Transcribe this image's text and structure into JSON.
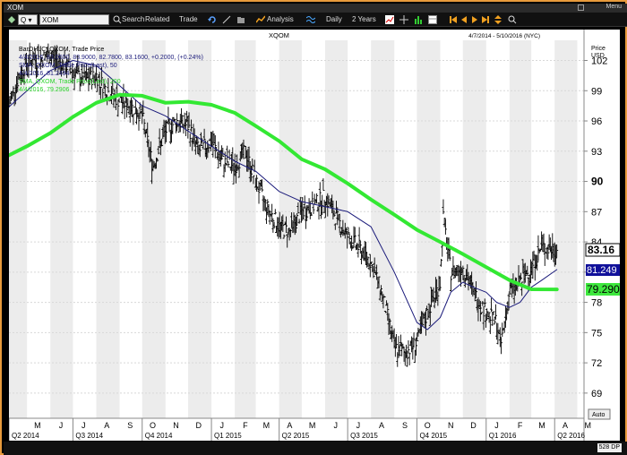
{
  "window": {
    "title": "XOM",
    "menu_label": "Menu"
  },
  "toolbar": {
    "type_selector": "Q",
    "symbol_value": "XOM",
    "search_label": "Search",
    "related_label": "Related",
    "trade_label": "Trade",
    "analysis_label": "Analysis",
    "interval_label": "Daily",
    "range_label": "2 Years"
  },
  "chart_header": {
    "symbol_title": "XQOM",
    "date_range": "4/7/2014 - 5/10/2016 (NYC)",
    "price_label_1": "Price",
    "price_label_2": "USD",
    "legend_line1": "BarOHLC, QXOM, Trade Price",
    "legend_line2": "4/4/2016, 83.0600, 83.9000, 82.7800, 83.1600, +0.2000, (+0.24%)",
    "legend_line3": "SMA, QXOM, Trade Price(Last), 50",
    "legend_line4": "4/4/2016, 81.2494",
    "legend_line5": "SMA, QXOM, Trade Price(Last), 200",
    "legend_line6": "4/4/2016, 79.2906"
  },
  "price_tags": {
    "last": "83.16",
    "sma50": "81.249",
    "sma200": "79.290"
  },
  "auto_label": "Auto",
  "bottom": {
    "dp_label": "528 DP"
  },
  "chart_data": {
    "type": "line",
    "y_ticks": [
      69,
      72,
      75,
      78,
      81,
      84,
      87,
      90,
      93,
      96,
      99,
      102
    ],
    "ylim": [
      66.5,
      104
    ],
    "grid": true,
    "month_labels": [
      "M",
      "J",
      "J",
      "A",
      "S",
      "O",
      "N",
      "D",
      "J",
      "F",
      "M",
      "A",
      "M",
      "J",
      "J",
      "A",
      "S",
      "O",
      "N",
      "D",
      "J",
      "F",
      "M",
      "A",
      "M"
    ],
    "quarter_labels": [
      "Q2 2014",
      "Q3 2014",
      "Q4 2014",
      "Q1 2015",
      "Q2 2015",
      "Q3 2015",
      "Q4 2015",
      "Q1 2016",
      "Q2 2016"
    ],
    "series": [
      {
        "name": "BarOHLC, QXOM, Trade Price",
        "color": "#000000",
        "x": [
          "2014-04-07",
          "2014-04-15",
          "2014-05-01",
          "2014-06-01",
          "2014-07-01",
          "2014-07-15",
          "2014-08-01",
          "2014-08-15",
          "2014-09-01",
          "2014-09-15",
          "2014-10-01",
          "2014-10-15",
          "2014-11-01",
          "2014-11-15",
          "2014-12-01",
          "2014-12-15",
          "2015-01-01",
          "2015-01-15",
          "2015-02-01",
          "2015-02-15",
          "2015-03-01",
          "2015-03-15",
          "2015-04-01",
          "2015-04-15",
          "2015-05-01",
          "2015-05-15",
          "2015-06-01",
          "2015-06-15",
          "2015-07-01",
          "2015-07-15",
          "2015-08-01",
          "2015-08-15",
          "2015-08-25",
          "2015-09-01",
          "2015-09-15",
          "2015-10-01",
          "2015-10-15",
          "2015-11-01",
          "2015-11-05",
          "2015-11-15",
          "2015-12-01",
          "2015-12-15",
          "2016-01-01",
          "2016-01-15",
          "2016-01-20",
          "2016-02-01",
          "2016-02-15",
          "2016-03-01",
          "2016-03-15",
          "2016-04-04"
        ],
        "values": [
          97.5,
          99.5,
          101.8,
          102.5,
          101,
          100,
          100.5,
          99,
          98,
          97.5,
          96.5,
          91.5,
          95,
          96,
          95.5,
          93,
          94,
          92,
          91.5,
          93,
          90,
          87.5,
          85.5,
          85,
          87,
          87.5,
          88.5,
          86.5,
          84.5,
          83.5,
          82,
          79,
          76,
          73.5,
          73,
          74,
          77,
          80,
          86.5,
          81,
          81.5,
          79,
          77,
          76,
          73.5,
          79,
          80,
          81.5,
          83.5,
          83.16
        ]
      },
      {
        "name": "SMA, QXOM, Trade Price(Last), 50",
        "color": "#1a1a7a",
        "x": [
          "2014-04-07",
          "2014-05-01",
          "2014-06-01",
          "2014-07-01",
          "2014-08-01",
          "2014-09-01",
          "2014-10-01",
          "2014-11-01",
          "2014-12-01",
          "2015-01-01",
          "2015-02-01",
          "2015-03-01",
          "2015-04-01",
          "2015-05-01",
          "2015-06-01",
          "2015-07-01",
          "2015-08-01",
          "2015-09-01",
          "2015-10-01",
          "2015-10-15",
          "2015-11-01",
          "2015-11-15",
          "2015-12-01",
          "2015-12-15",
          "2016-01-01",
          "2016-01-15",
          "2016-02-01",
          "2016-02-15",
          "2016-03-01",
          "2016-03-15",
          "2016-04-04"
        ],
        "values": [
          97.4,
          99,
          101,
          102,
          101.5,
          99.5,
          97.5,
          96.5,
          95,
          93.5,
          92,
          91,
          89,
          88,
          87.5,
          87,
          85.5,
          81,
          76,
          75.3,
          76.5,
          79,
          80,
          79.5,
          79,
          78,
          77.5,
          78,
          79.5,
          80.2,
          81.25
        ]
      },
      {
        "name": "SMA, QXOM, Trade Price(Last), 200",
        "color": "#33e833",
        "x": [
          "2014-04-07",
          "2014-05-01",
          "2014-06-01",
          "2014-07-01",
          "2014-08-01",
          "2014-09-01",
          "2014-10-01",
          "2014-11-01",
          "2014-12-01",
          "2015-01-01",
          "2015-02-01",
          "2015-03-01",
          "2015-04-01",
          "2015-05-01",
          "2015-06-01",
          "2015-07-01",
          "2015-08-01",
          "2015-09-01",
          "2015-10-01",
          "2015-11-01",
          "2015-12-01",
          "2016-01-01",
          "2016-02-01",
          "2016-03-01",
          "2016-04-04"
        ],
        "values": [
          92.6,
          93.5,
          94.8,
          96.4,
          97.8,
          98.6,
          98.5,
          97.8,
          97.9,
          97.6,
          96.8,
          95.5,
          94,
          92.2,
          91.2,
          89.8,
          88.2,
          86.7,
          85.2,
          84,
          82.8,
          81.5,
          80.2,
          79.3,
          79.29
        ]
      }
    ]
  }
}
